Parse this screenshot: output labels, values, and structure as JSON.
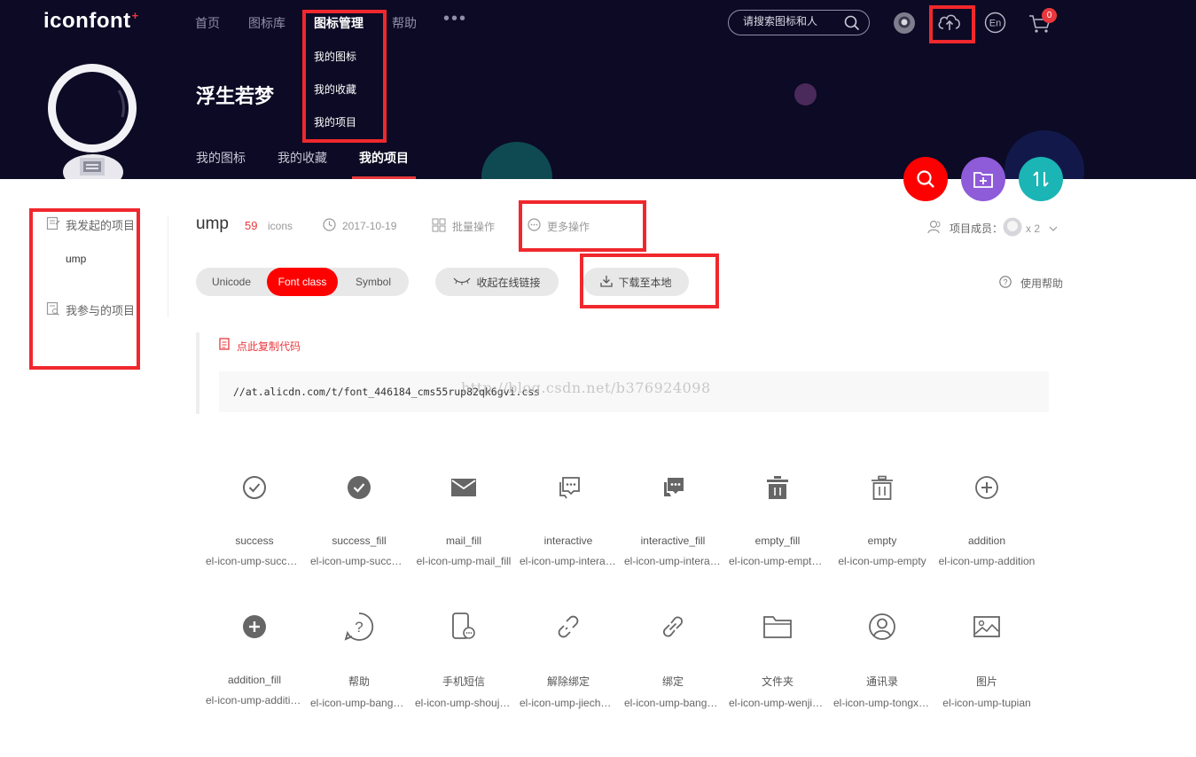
{
  "header": {
    "logo": "iconfont",
    "logo_plus": "+",
    "nav": [
      "首页",
      "图标库",
      "图标管理",
      "帮助"
    ],
    "nav_more": "•••",
    "dropdown": [
      "我的图标",
      "我的收藏",
      "我的项目"
    ],
    "search_placeholder": "请搜索图标和人",
    "lang_icon_text": "En",
    "cart_count": "0"
  },
  "profile": {
    "username": "浮生若梦",
    "tabs": [
      "我的图标",
      "我的收藏",
      "我的项目"
    ]
  },
  "sidebar": {
    "created_projects": "我发起的项目",
    "project_item": "ump",
    "joined_projects": "我参与的项目"
  },
  "project": {
    "name": "ump",
    "icon_count": "59",
    "icons_label": "icons",
    "date": "2017-10-19",
    "batch_ops": "批量操作",
    "more_ops": "更多操作",
    "members_label": "项目成员：",
    "members_count": "x 2",
    "tabs": [
      "Unicode",
      "Font class",
      "Symbol"
    ],
    "active_tab": "Font class",
    "collapse_link": "收起在线链接",
    "download": "下载至本地",
    "help": "使用帮助",
    "copy_code": "点此复制代码",
    "code_url": "//at.alicdn.com/t/font_446184_cms55rup82qk6gvi.css",
    "watermark": "http://blog.csdn.net/b376924098"
  },
  "icons": [
    {
      "name": "success",
      "cls": "el-icon-ump-success",
      "icon": "check-circle-icon"
    },
    {
      "name": "success_fill",
      "cls": "el-icon-ump-success_fill",
      "icon": "check-circle-fill-icon"
    },
    {
      "name": "mail_fill",
      "cls": "el-icon-ump-mail_fill",
      "icon": "mail-fill-icon"
    },
    {
      "name": "interactive",
      "cls": "el-icon-ump-interactive",
      "icon": "chat-icon"
    },
    {
      "name": "interactive_fill",
      "cls": "el-icon-ump-interactive_fill",
      "icon": "chat-fill-icon"
    },
    {
      "name": "empty_fill",
      "cls": "el-icon-ump-empty_fill",
      "icon": "trash-fill-icon"
    },
    {
      "name": "empty",
      "cls": "el-icon-ump-empty",
      "icon": "trash-icon"
    },
    {
      "name": "addition",
      "cls": "el-icon-ump-addition",
      "icon": "plus-circle-icon"
    },
    {
      "name": "addition_fill",
      "cls": "el-icon-ump-addition_fill",
      "icon": "plus-circle-fill-icon"
    },
    {
      "name": "帮助",
      "cls": "el-icon-ump-bangzhu",
      "icon": "help-circle-icon"
    },
    {
      "name": "手机短信",
      "cls": "el-icon-ump-shoujiduanxin",
      "icon": "phone-message-icon"
    },
    {
      "name": "解除绑定",
      "cls": "el-icon-ump-jiechubangding",
      "icon": "unlink-icon"
    },
    {
      "name": "绑定",
      "cls": "el-icon-ump-bangding",
      "icon": "link-icon"
    },
    {
      "name": "文件夹",
      "cls": "el-icon-ump-wenjianjia",
      "icon": "folder-icon"
    },
    {
      "name": "通讯录",
      "cls": "el-icon-ump-tongxunlu",
      "icon": "contact-icon"
    },
    {
      "name": "图片",
      "cls": "el-icon-ump-tupian",
      "icon": "image-icon"
    }
  ],
  "colors": {
    "header_bg": "#0c0a24",
    "accent_red": "#ff0000",
    "annotation_red": "#f0282d",
    "fab_search": "#ff0000",
    "fab_add": "#8e5bd9",
    "fab_sort": "#1bb5b5"
  }
}
